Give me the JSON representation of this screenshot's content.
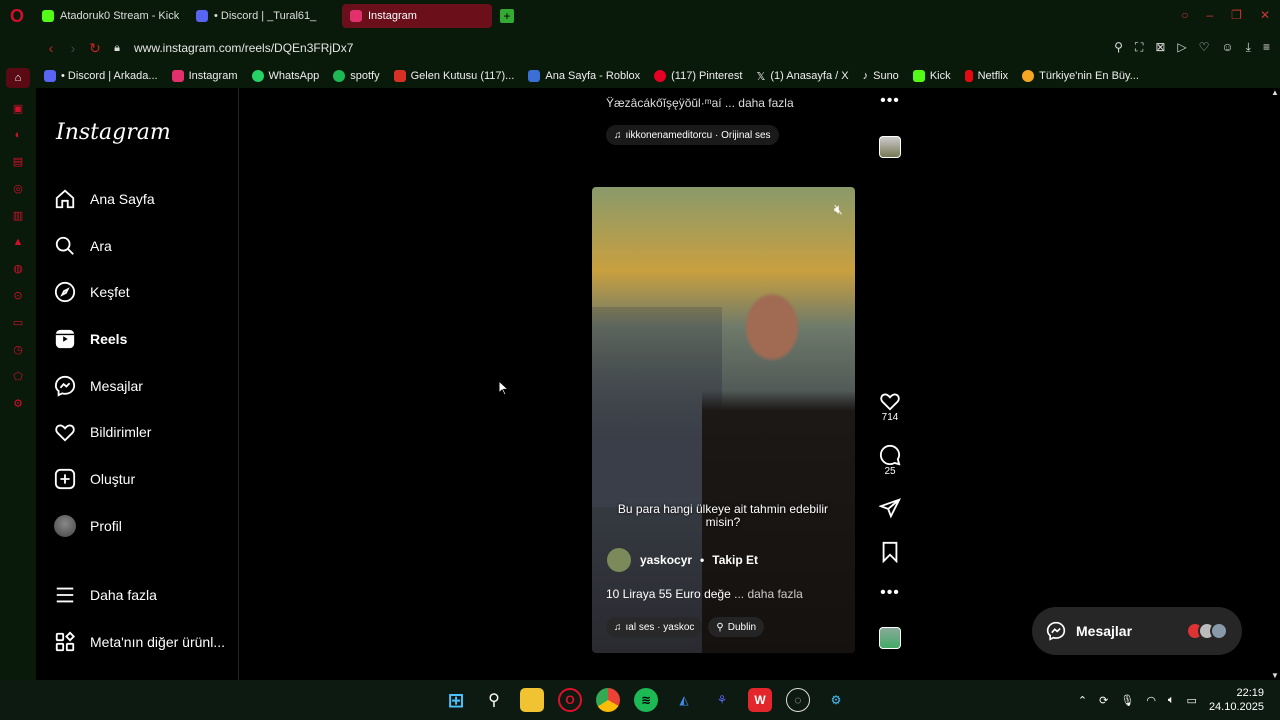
{
  "browser": {
    "tabs": [
      {
        "label": "Atadoruk0 Stream - Kick",
        "color": "#53fc18",
        "active": false
      },
      {
        "label": "• Discord | _Tural61_",
        "color": "#5865f2",
        "active": false
      },
      {
        "label": "Instagram",
        "color": "#e1306c",
        "active": true
      }
    ],
    "url": "www.instagram.com/reels/DQEn3FRjDx7",
    "bookmarks": [
      {
        "label": "• Discord | Arkada...",
        "color": "#5865f2"
      },
      {
        "label": "Instagram",
        "color": "#e1306c"
      },
      {
        "label": "WhatsApp",
        "color": "#25d366"
      },
      {
        "label": "spotfy",
        "color": "#1db954"
      },
      {
        "label": "Gelen Kutusu (117)...",
        "color": "#d93025"
      },
      {
        "label": "Ana Sayfa - Roblox",
        "color": "#3b6fd6"
      },
      {
        "label": "(117) Pinterest",
        "color": "#e60023"
      },
      {
        "label": "(1) Anasayfa / X",
        "color": "#ffffff"
      },
      {
        "label": "Suno",
        "color": "#ffffff"
      },
      {
        "label": "Kick",
        "color": "#53fc18"
      },
      {
        "label": "Netflix",
        "color": "#e50914"
      },
      {
        "label": "Türkiye'nin En Büy...",
        "color": "#f5a623"
      }
    ]
  },
  "instagram": {
    "logo": "Instagram",
    "nav": [
      {
        "label": "Ana Sayfa",
        "icon": "home-icon"
      },
      {
        "label": "Ara",
        "icon": "search-icon"
      },
      {
        "label": "Keşfet",
        "icon": "compass-icon"
      },
      {
        "label": "Reels",
        "icon": "reels-icon"
      },
      {
        "label": "Mesajlar",
        "icon": "messenger-icon"
      },
      {
        "label": "Bildirimler",
        "icon": "heart-icon"
      },
      {
        "label": "Oluştur",
        "icon": "plus-square-icon"
      },
      {
        "label": "Profil",
        "icon": "avatar"
      },
      {
        "label": "Daha fazla",
        "icon": "menu-icon"
      },
      {
        "label": "Meta'nın diğer ürünl...",
        "icon": "apps-icon"
      }
    ],
    "previous_reel": {
      "caption": "Ÿæzâcákőĭşęÿŏŭl·ᵐaí ... daha fazla",
      "audio": "ıikkonenameditorcu · Orijinal ses"
    },
    "reel": {
      "subtitle": "Bu para hangi ülkeye ait tahmin edebilir misin?",
      "author": "yaskocyr",
      "separator": "•",
      "follow": "Takip Et",
      "caption": "10 Liraya 55 Euro değe",
      "more": "... daha fazla",
      "audio": "ıal ses · yaskoc",
      "location": "Dublin",
      "likes": "714",
      "comments": "25"
    },
    "messages_float": "Mesajlar"
  },
  "taskbar": {
    "time": "22:19",
    "date": "24.10.2025"
  }
}
